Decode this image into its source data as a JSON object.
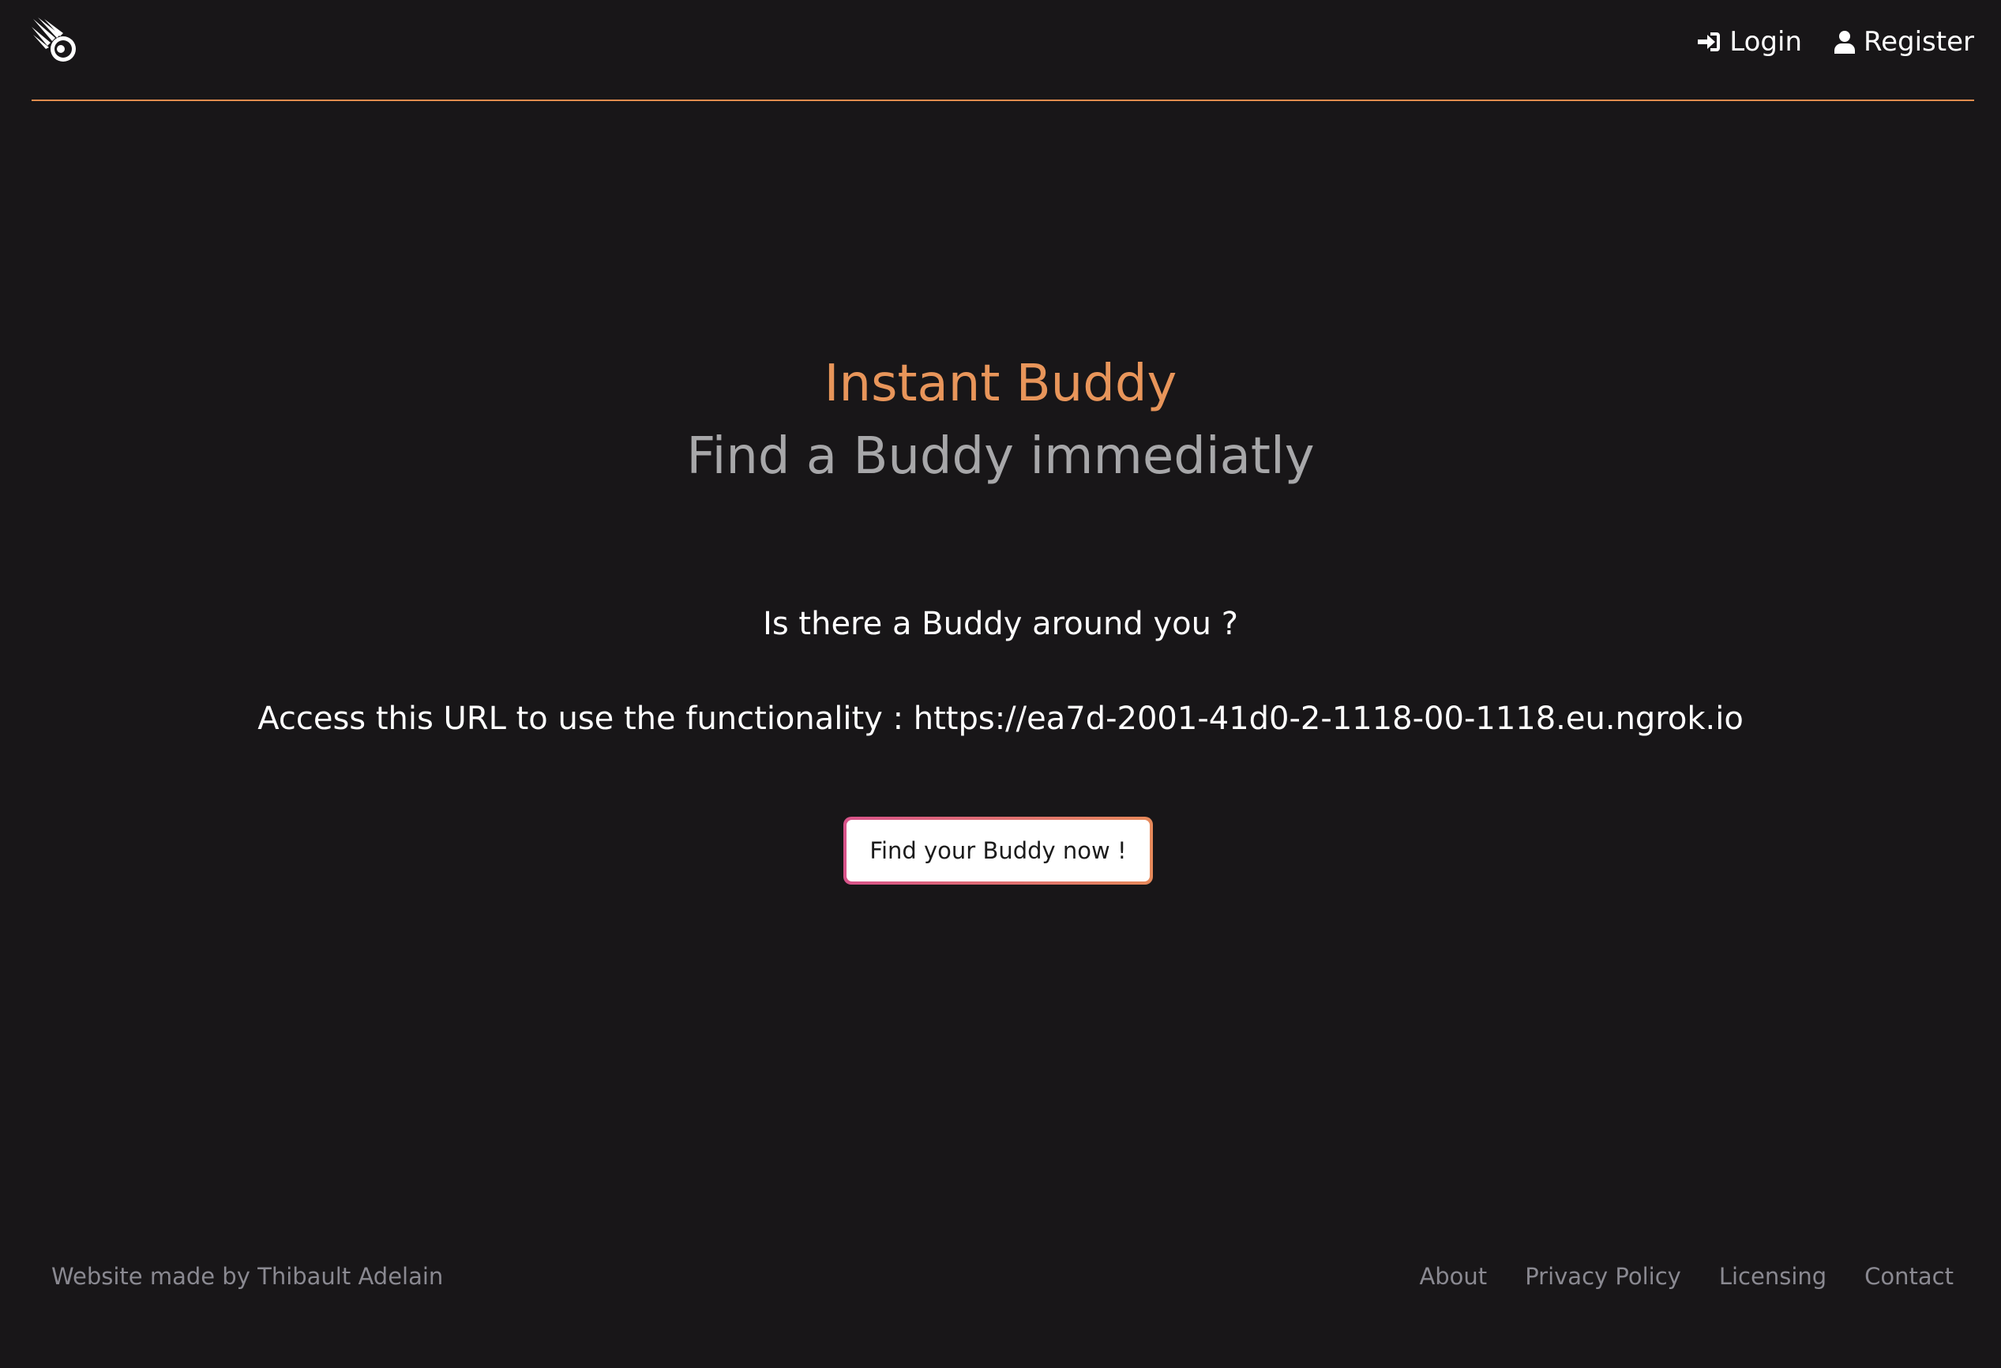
{
  "header": {
    "logo_icon": "comet-icon",
    "nav": {
      "login_label": "Login",
      "login_icon": "sign-in-icon",
      "register_label": "Register",
      "register_icon": "user-icon"
    },
    "divider_color": "#e08c4e"
  },
  "hero": {
    "title": "Instant Buddy",
    "subtitle": "Find a Buddy immediatly",
    "question": "Is there a Buddy around you ?",
    "url_text": "Access this URL to use the functionality : https://ea7d-2001-41d0-2-1118-00-1118.eu.ngrok.io",
    "cta_label": "Find your Buddy now !"
  },
  "footer": {
    "credit": "Website made by Thibault Adelain",
    "links": [
      {
        "label": "About"
      },
      {
        "label": "Privacy Policy"
      },
      {
        "label": "Licensing"
      },
      {
        "label": "Contact"
      }
    ]
  },
  "colors": {
    "background": "#181618",
    "accent": "#e8955a",
    "subtitle": "#a7a7a9",
    "footer_text": "#8a8991",
    "cta_gradient_start": "#d8538a",
    "cta_gradient_end": "#e6895a"
  }
}
